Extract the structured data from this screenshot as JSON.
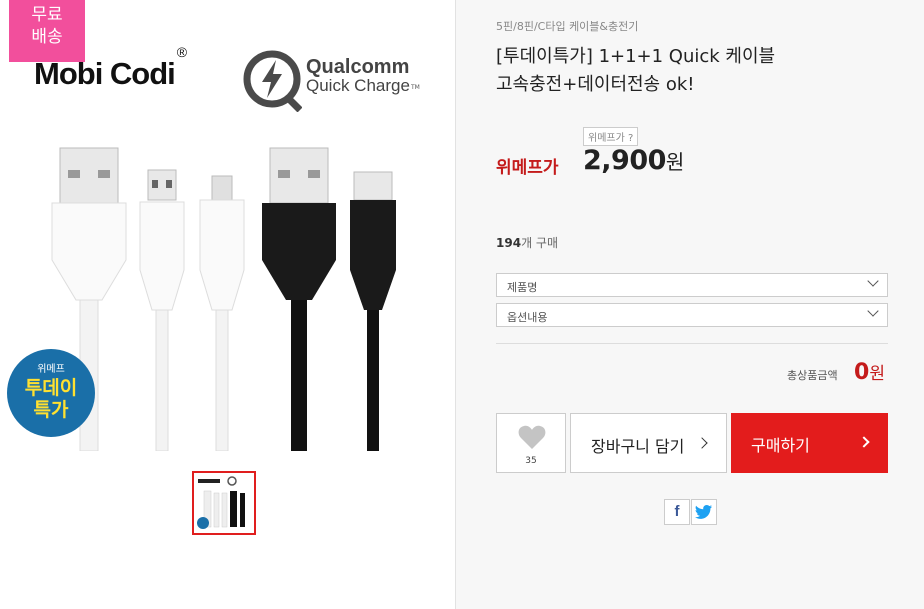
{
  "image": {
    "free_shipping_badge": [
      "무료",
      "배송"
    ],
    "brand_logo": "Mobi Codi",
    "brand_reg_mark": "®",
    "qc_logo_line1": "Qualcomm",
    "qc_logo_line2": "Quick Charge",
    "qc_tm": "TM",
    "promo_badge_line1": "위메프",
    "promo_badge_line2": "투데이",
    "promo_badge_line3": "특가"
  },
  "product": {
    "category": "5핀/8핀/C타입 케이블&충전기",
    "title_line1": "[투데이특가] 1+1+1 Quick 케이블",
    "title_line2": "고속충전+데이터전송 ok!",
    "price_tip": "위메프가 ?",
    "price_label": "위메프가",
    "price_value": "2,900",
    "price_unit": "원",
    "buy_count": "194",
    "buy_count_suffix": "개 구매"
  },
  "options": {
    "select1": "제품명",
    "select2": "옵션내용"
  },
  "total": {
    "label": "총상품금액",
    "value": "0",
    "unit": "원"
  },
  "actions": {
    "like_count": "35",
    "cart_label": "장바구니 담기",
    "buy_label": "구매하기"
  },
  "share": {
    "facebook_icon": "f",
    "twitter_icon": "twitter-bird"
  },
  "colors": {
    "accent_red": "#e31c1c",
    "badge_pink": "#f24f9c",
    "promo_blue": "#1a6fa8"
  }
}
